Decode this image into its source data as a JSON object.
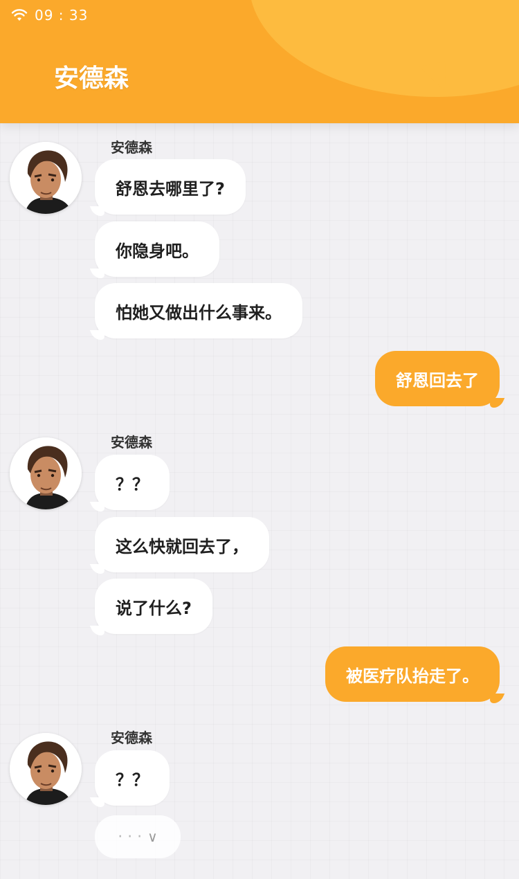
{
  "status_bar": {
    "time": "09 : 33",
    "wifi_icon": "wifi-icon"
  },
  "header": {
    "title": "安德森"
  },
  "chat": {
    "groups": [
      {
        "sender": "安德森",
        "messages": [
          "舒恩去哪里了?",
          "你隐身吧。",
          "怕她又做出什么事来。"
        ]
      },
      {
        "reply": "舒恩回去了"
      },
      {
        "sender": "安德森",
        "messages": [
          "？？",
          "这么快就回去了，",
          "说了什么?"
        ]
      },
      {
        "reply": "被医疗队抬走了。"
      },
      {
        "sender": "安德森",
        "messages": [
          "？？"
        ]
      }
    ],
    "typing_indicator": {
      "dots": "· · ·",
      "chevron": "∨"
    }
  },
  "colors": {
    "accent": "#fba92b",
    "background": "#f1f0f3",
    "bubble_left": "#ffffff"
  }
}
